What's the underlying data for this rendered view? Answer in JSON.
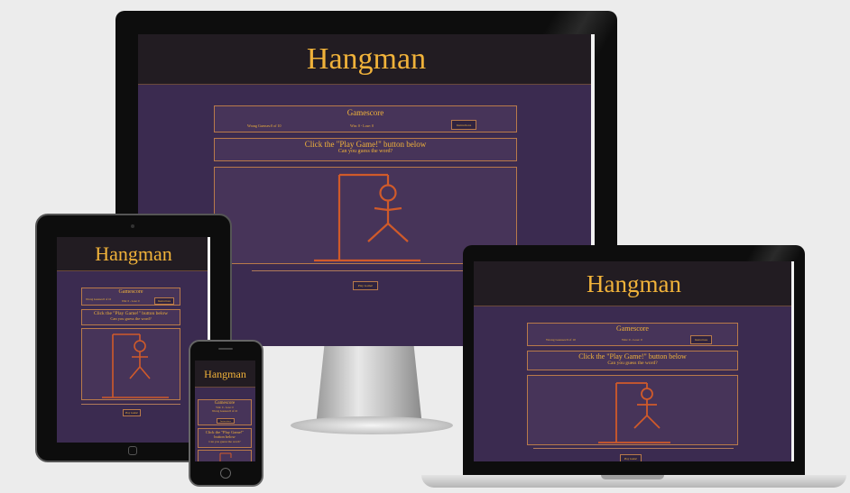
{
  "app": {
    "title": "Hangman",
    "scoreboard_title": "Gamescore",
    "wrong_guesses": "Wrong Guesses:0 of 10",
    "wins_losses": "Win: 0 - Lose: 0",
    "instructions_label": "Instructions",
    "prompt": "Click the \"Play Game!\" button below",
    "subprompt": "Can you guess the word?",
    "play_label": "Play Game!"
  },
  "colors": {
    "accent": "#f0b23a",
    "header_bg": "#221c22",
    "page_bg": "#3b2b50",
    "panel_bg": "#473459",
    "gallows": "#d05a2a"
  }
}
